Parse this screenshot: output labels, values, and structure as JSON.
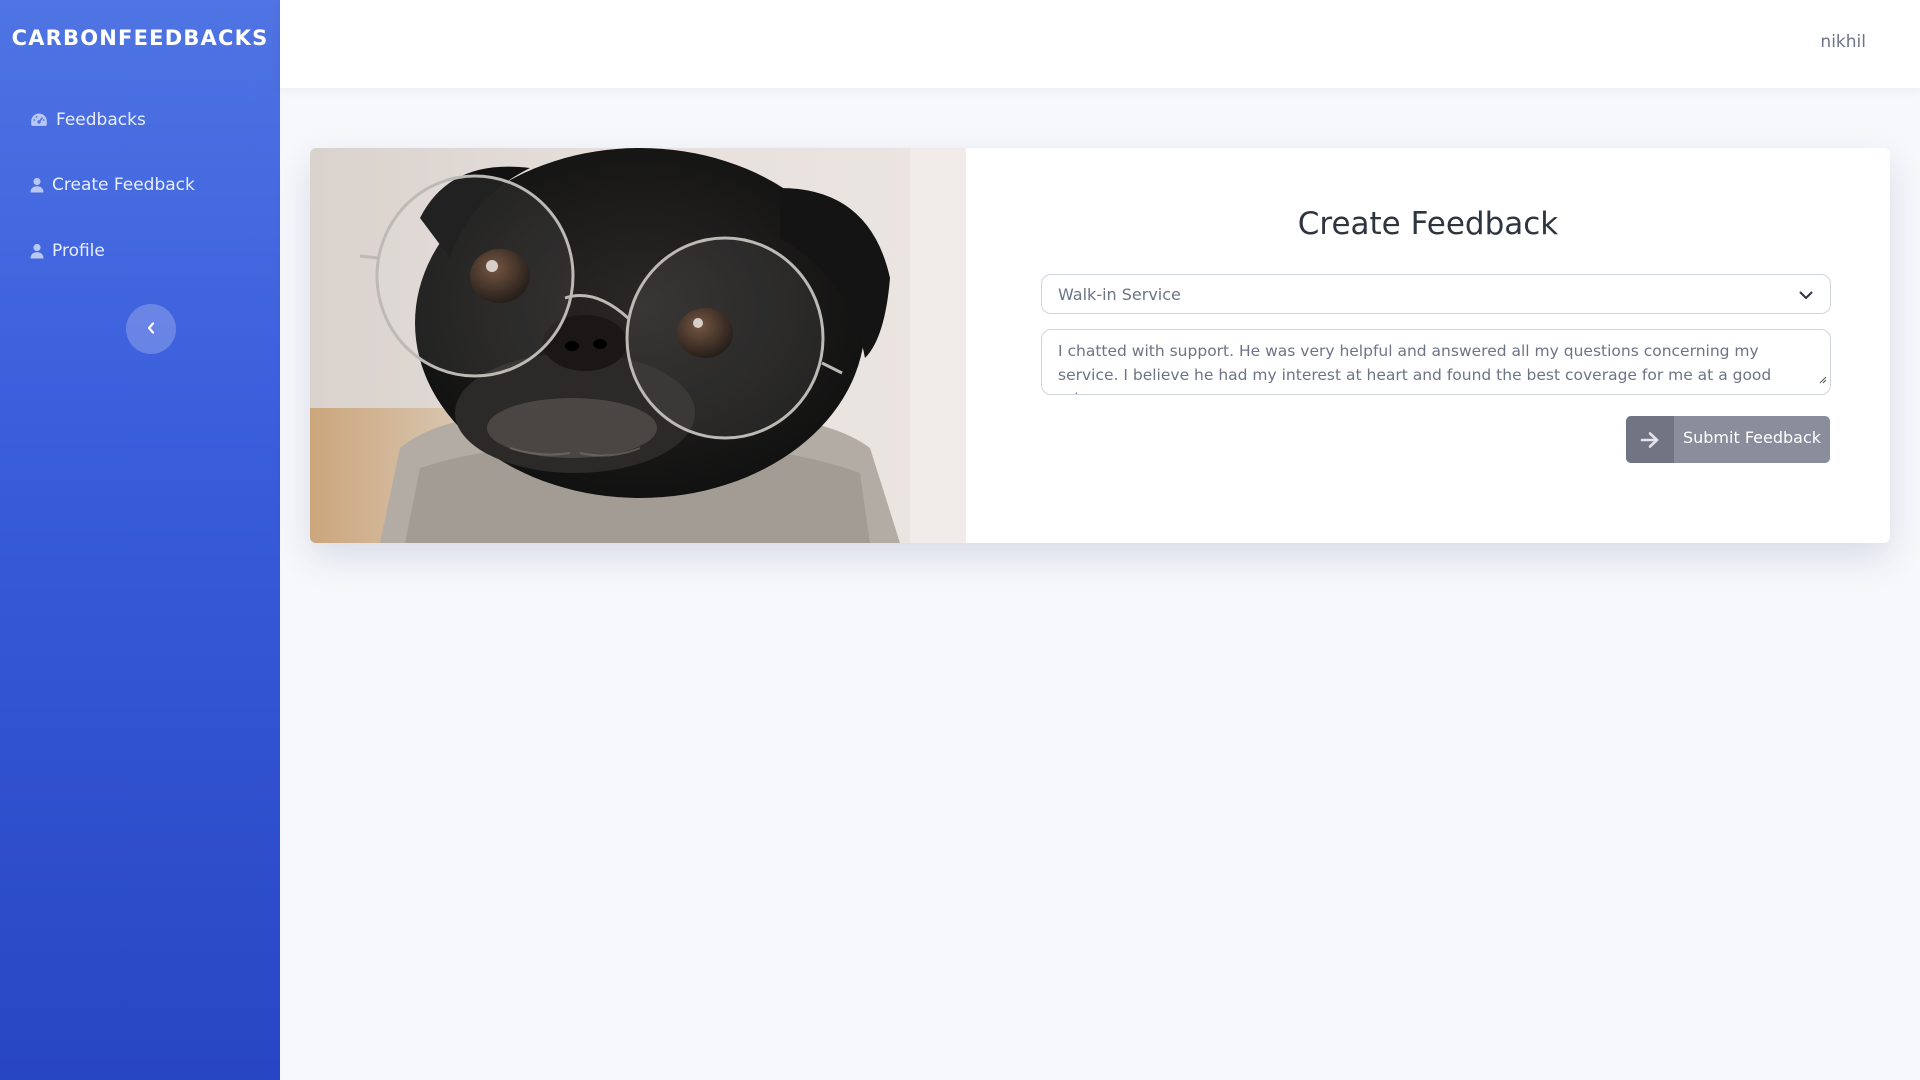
{
  "app": {
    "brand": "CARBONFEEDBACKS"
  },
  "sidebar": {
    "items": [
      {
        "label": "Feedbacks",
        "icon": "dashboard-gauge-icon"
      },
      {
        "label": "Create Feedback",
        "icon": "user-icon"
      },
      {
        "label": "Profile",
        "icon": "user-icon"
      }
    ],
    "collapse_icon": "chevron-left-icon"
  },
  "header": {
    "username": "nikhil"
  },
  "main": {
    "image": "pug-with-glasses-photo",
    "form": {
      "title": "Create Feedback",
      "category": {
        "selected": "Walk-in Service"
      },
      "feedback_text": "I chatted with support. He was very helpful and answered all my questions concerning my service. I believe he had my interest at heart and found the best coverage for me at a good price.",
      "submit_label": "Submit Feedback",
      "submit_icon": "arrow-right-icon"
    }
  },
  "colors": {
    "sidebar_top": "#4f74e3",
    "sidebar_bottom": "#2746c3",
    "page_background": "#f6f8fc",
    "submit_button": "#8a8d9b"
  }
}
